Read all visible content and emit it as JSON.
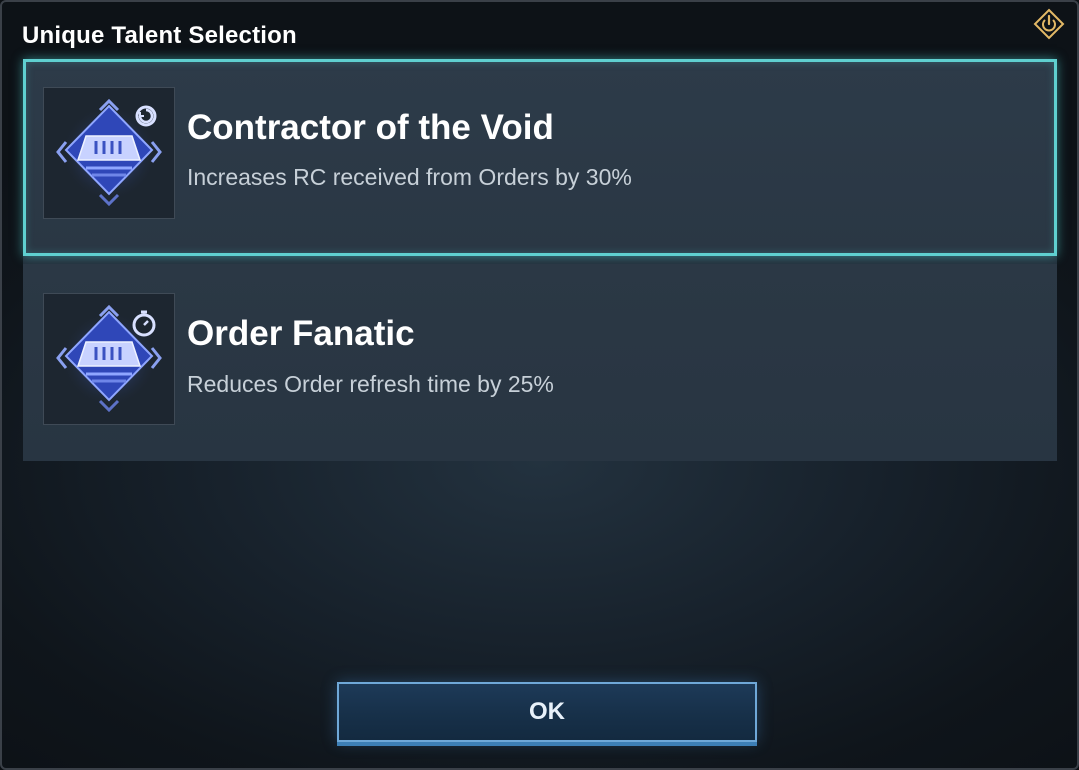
{
  "dialog": {
    "title": "Unique Talent Selection"
  },
  "talents": [
    {
      "name": "Contractor of the Void",
      "description": "Increases RC received from Orders by 30%",
      "selected": true,
      "badge_icon": "refresh-icon"
    },
    {
      "name": "Order Fanatic",
      "description": "Reduces Order refresh time by 25%",
      "selected": false,
      "badge_icon": "stopwatch-icon"
    }
  ],
  "buttons": {
    "ok_label": "OK"
  },
  "colors": {
    "selected_border": "#5fd0d0",
    "ok_border": "#6fa8d8",
    "power_icon": "#e2b866"
  }
}
